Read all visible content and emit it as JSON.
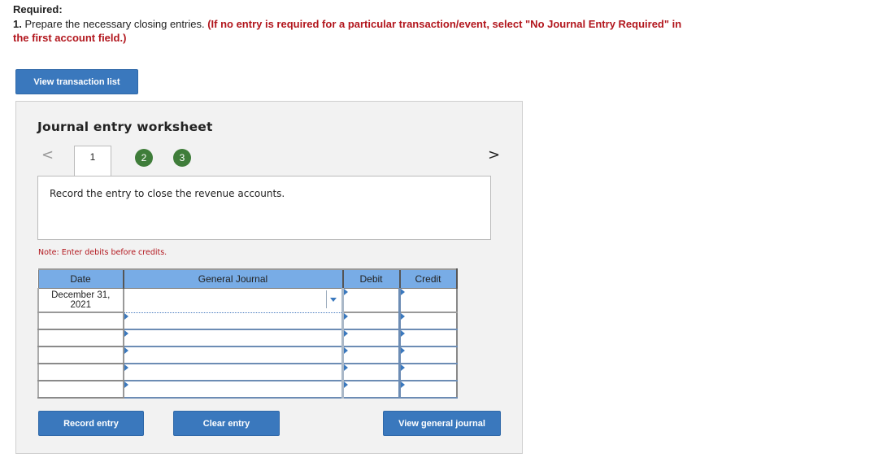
{
  "requirement": {
    "title": "Required:",
    "number": "1.",
    "text": " Prepare the necessary closing entries.",
    "instruction": " (If no entry is required for a particular transaction/event, select \"No Journal Entry Required\" in the first account field.)"
  },
  "buttons": {
    "view_transaction_list": "View transaction list",
    "record_entry": "Record entry",
    "clear_entry": "Clear entry",
    "view_general_journal": "View general journal"
  },
  "worksheet": {
    "title": "Journal entry worksheet",
    "nav": {
      "prev_icon": "chevron-left-icon",
      "prev": "<",
      "next_icon": "chevron-right-icon",
      "next": ">"
    },
    "tabs": [
      {
        "label": "1",
        "state": "active"
      },
      {
        "label": "2",
        "state": "completed"
      },
      {
        "label": "3",
        "state": "completed"
      }
    ],
    "instruction": "Record the entry to close the revenue accounts.",
    "note": "Note: Enter debits before credits.",
    "colors": {
      "header_bg": "#78ace6",
      "button_bg": "#3a78bd",
      "tab_done": "#3f7d3a",
      "note": "#b2161d"
    }
  },
  "journal_table": {
    "headers": {
      "date": "Date",
      "general_journal": "General Journal",
      "debit": "Debit",
      "credit": "Credit"
    },
    "rows": [
      {
        "date": "December 31, 2021",
        "account": "",
        "debit": "",
        "credit": ""
      },
      {
        "date": "",
        "account": "",
        "debit": "",
        "credit": ""
      },
      {
        "date": "",
        "account": "",
        "debit": "",
        "credit": ""
      },
      {
        "date": "",
        "account": "",
        "debit": "",
        "credit": ""
      },
      {
        "date": "",
        "account": "",
        "debit": "",
        "credit": ""
      },
      {
        "date": "",
        "account": "",
        "debit": "",
        "credit": ""
      }
    ]
  }
}
